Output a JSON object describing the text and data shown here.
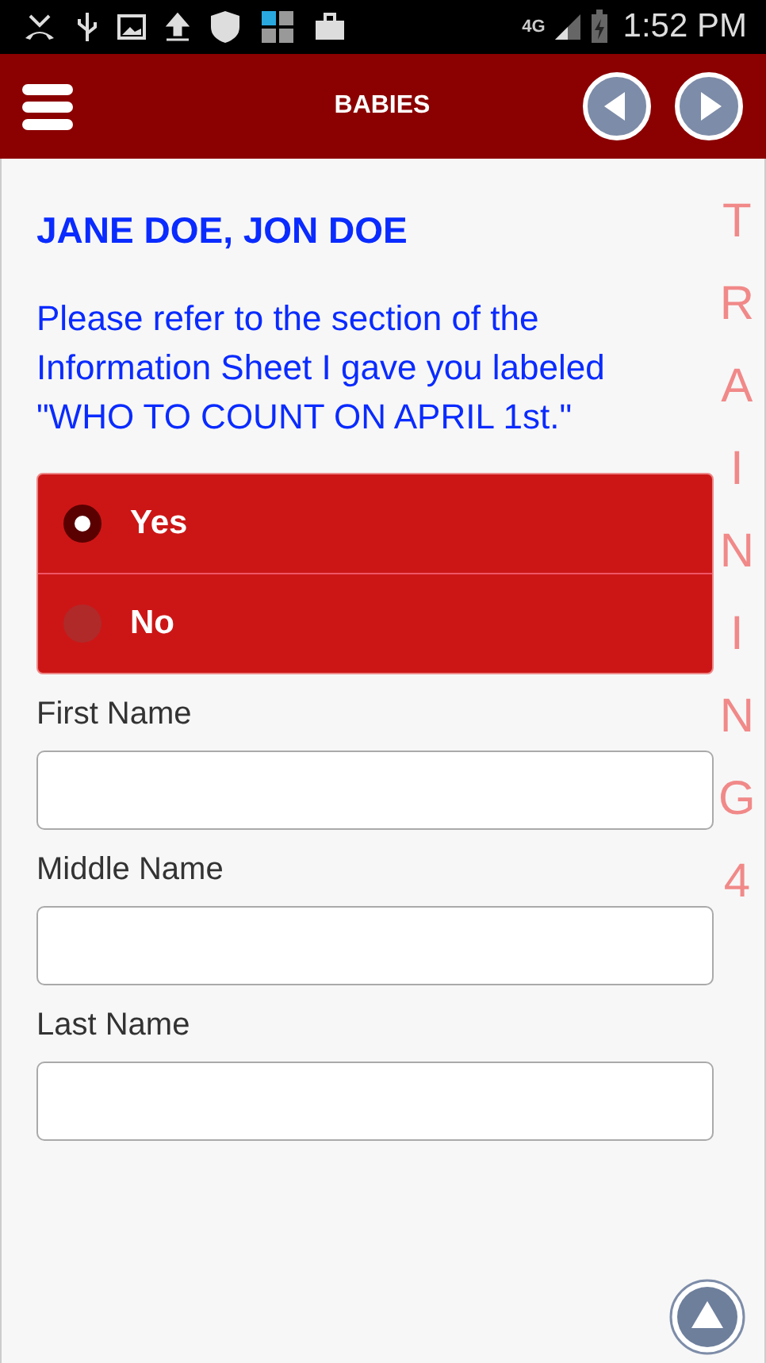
{
  "status_bar": {
    "network": "4G",
    "time": "1:52 PM"
  },
  "header": {
    "title": "BABIES"
  },
  "heading": "JANE DOE, JON DOE",
  "instruction": "Please refer to the section of the Information Sheet I gave you labeled \"WHO TO COUNT ON APRIL 1st.\"",
  "options": [
    {
      "label": "Yes",
      "selected": true
    },
    {
      "label": "No",
      "selected": false
    }
  ],
  "fields": [
    {
      "label": "First Name"
    },
    {
      "label": "Middle Name"
    },
    {
      "label": "Last Name"
    }
  ],
  "overlay": "TRAINING4"
}
